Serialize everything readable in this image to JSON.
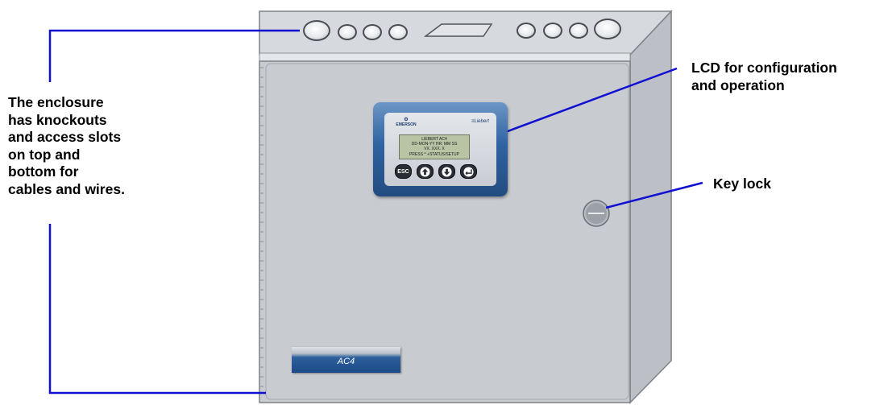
{
  "callouts": {
    "enclosure": "The enclosure\nhas knockouts\nand access slots\non top and\nbottom for\ncables and wires.",
    "lcd": "LCD for configuration\nand operation",
    "key_lock": "Key lock"
  },
  "panel": {
    "brand_left": "EMERSON",
    "brand_right": "Liebert",
    "lcd_lines": [
      "LIEBERT AC4",
      "DD-MON-YY HR: MM SS",
      "VX. XXX. X",
      "PRESS ^ +STATUS/SETUP"
    ],
    "esc_label": "ESC"
  },
  "badge": {
    "label": "AC4"
  },
  "colors": {
    "leader_line": "#1010d0",
    "cabinet_face": "#c8cbd0",
    "panel_blue": "#2f63a1"
  },
  "icons": [
    "up-arrow-icon",
    "down-arrow-icon",
    "enter-icon"
  ]
}
